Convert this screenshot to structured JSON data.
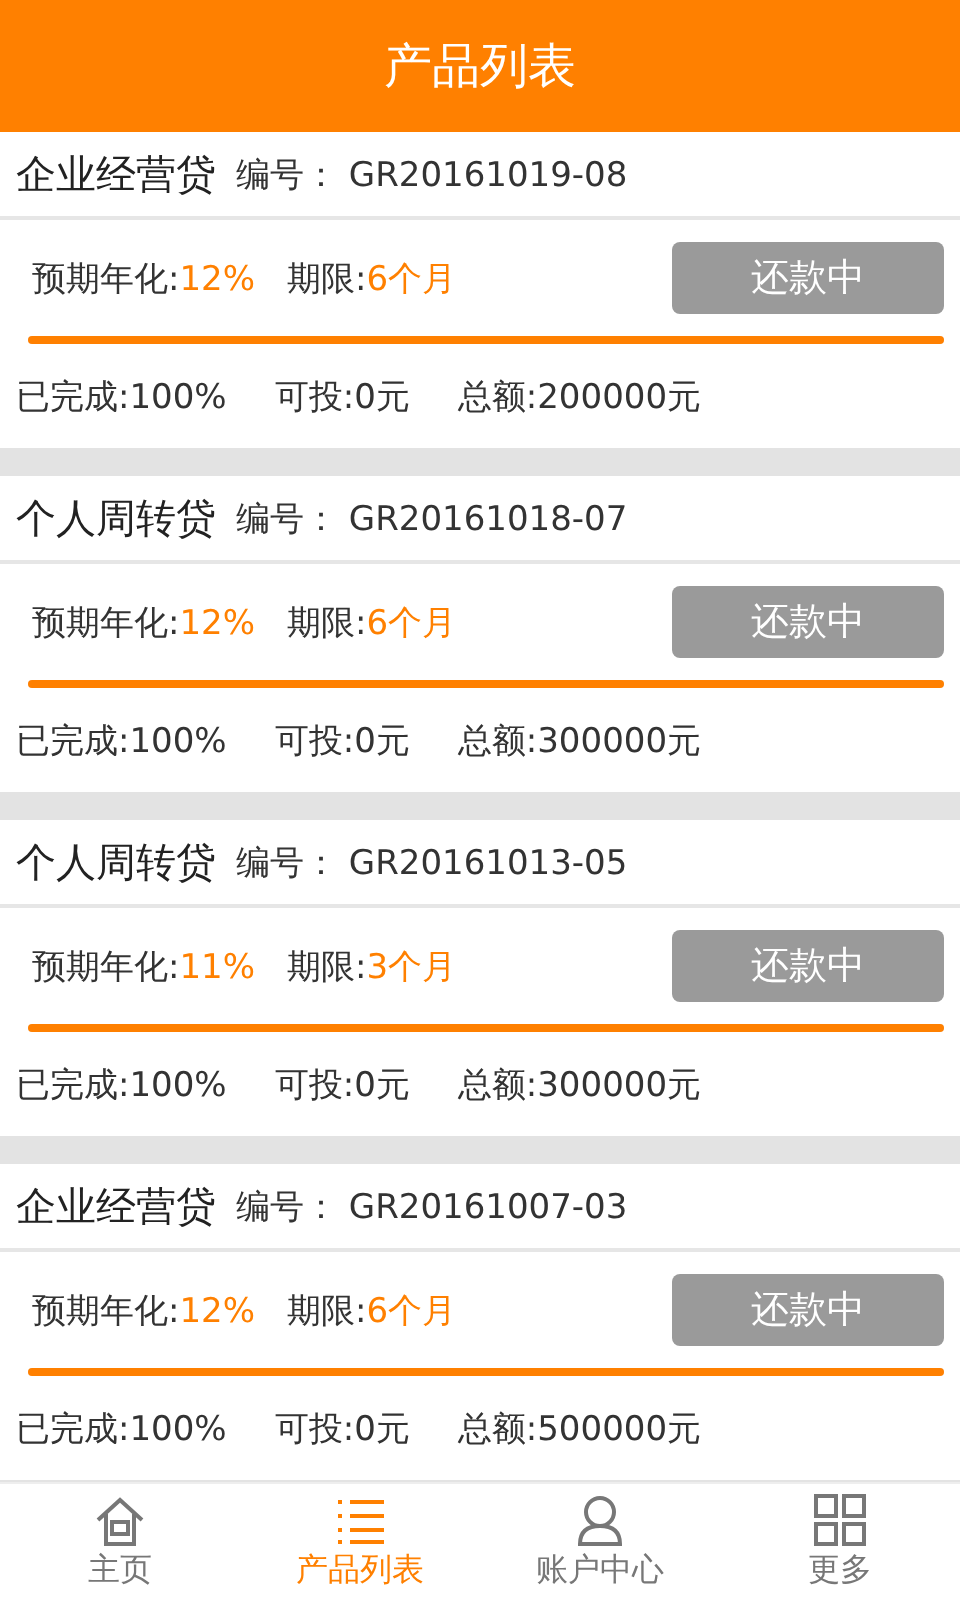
{
  "header": {
    "title": "产品列表"
  },
  "products": [
    {
      "name": "企业经营贷",
      "code_label": "编号：",
      "code": "GR20161019-08",
      "rate_label": "预期年化:",
      "rate": "12%",
      "term_label": "期限:",
      "term": "6个月",
      "status": "还款中",
      "level": 1,
      "done": "已完成:100%",
      "available": "可投:0元",
      "total": "总额:200000元"
    },
    {
      "name": "个人周转贷",
      "code_label": "编号：",
      "code": "GR20161018-07",
      "rate_label": "预期年化:",
      "rate": "12%",
      "term_label": "期限:",
      "term": "6个月",
      "status": "还款中",
      "level": 1,
      "done": "已完成:100%",
      "available": "可投:0元",
      "total": "总额:300000元"
    },
    {
      "name": "个人周转贷",
      "code_label": "编号：",
      "code": "GR20161013-05",
      "rate_label": "预期年化:",
      "rate": "11%",
      "term_label": "期限:",
      "term": "3个月",
      "status": "还款中",
      "level": 1,
      "done": "已完成:100%",
      "available": "可投:0元",
      "total": "总额:300000元"
    },
    {
      "name": "企业经营贷",
      "code_label": "编号：",
      "code": "GR20161007-03",
      "rate_label": "预期年化:",
      "rate": "12%",
      "term_label": "期限:",
      "term": "6个月",
      "status": "还款中",
      "level": 1,
      "done": "已完成:100%",
      "available": "可投:0元",
      "total": "总额:500000元"
    }
  ],
  "tabs": [
    {
      "kind": "home",
      "label": "主页",
      "selected": false
    },
    {
      "kind": "list",
      "label": "产品列表",
      "selected": true
    },
    {
      "kind": "user",
      "label": "账户中心",
      "selected": false
    },
    {
      "kind": "grid",
      "label": "更多",
      "selected": false
    }
  ]
}
